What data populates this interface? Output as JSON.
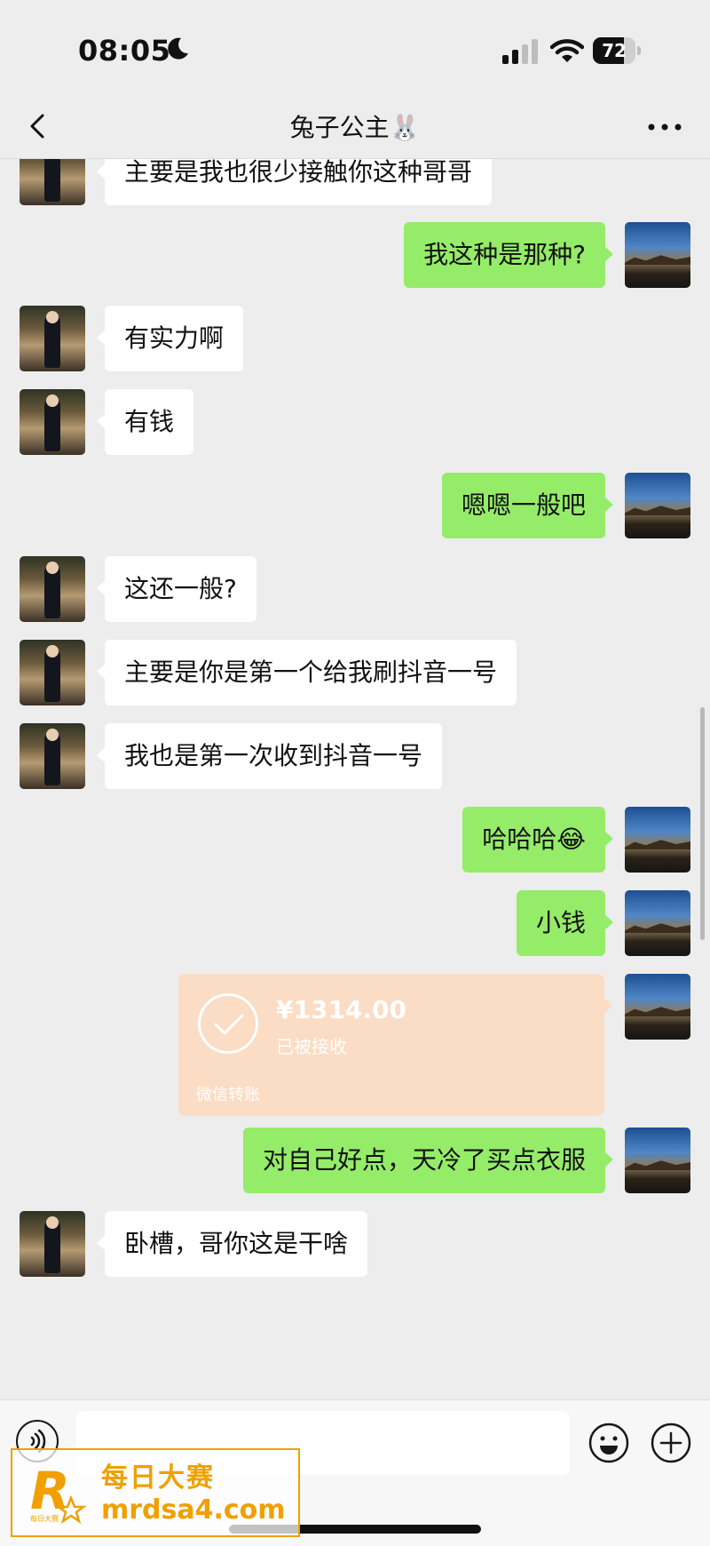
{
  "status_bar": {
    "time": "08:05",
    "battery": "72",
    "battery_level": 0.72
  },
  "nav": {
    "title": "兔子公主🐰"
  },
  "messages": [
    {
      "side": "left",
      "text": "主要是我也很少接触你这种哥哥"
    },
    {
      "side": "right",
      "text": "我这种是那种?"
    },
    {
      "side": "left",
      "text": "有实力啊"
    },
    {
      "side": "left",
      "text": "有钱"
    },
    {
      "side": "right",
      "text": "嗯嗯一般吧"
    },
    {
      "side": "left",
      "text": "这还一般?"
    },
    {
      "side": "left",
      "text": "主要是你是第一个给我刷抖音一号"
    },
    {
      "side": "left",
      "text": "我也是第一次收到抖音一号"
    },
    {
      "side": "right",
      "text": "哈哈哈😂"
    },
    {
      "side": "right",
      "text": "小钱"
    },
    {
      "side": "right",
      "type": "transfer",
      "amount": "¥1314.00",
      "status": "已被接收",
      "label": "微信转账"
    },
    {
      "side": "right",
      "text": "对自己好点，天冷了买点衣服"
    },
    {
      "side": "left",
      "text": "卧槽，哥你这是干啥"
    }
  ],
  "input": {
    "value": "",
    "placeholder": ""
  },
  "watermark": {
    "line1": "每日大赛",
    "line2": "mrdsa4.com",
    "logo_letter": "R",
    "logo_small": "每日大赛"
  },
  "colors": {
    "background": "#ededed",
    "bubble_mine": "#95ec69",
    "bubble_theirs": "#ffffff",
    "transfer_accepted": "#fbdcc4",
    "watermark": "#f0a000"
  }
}
